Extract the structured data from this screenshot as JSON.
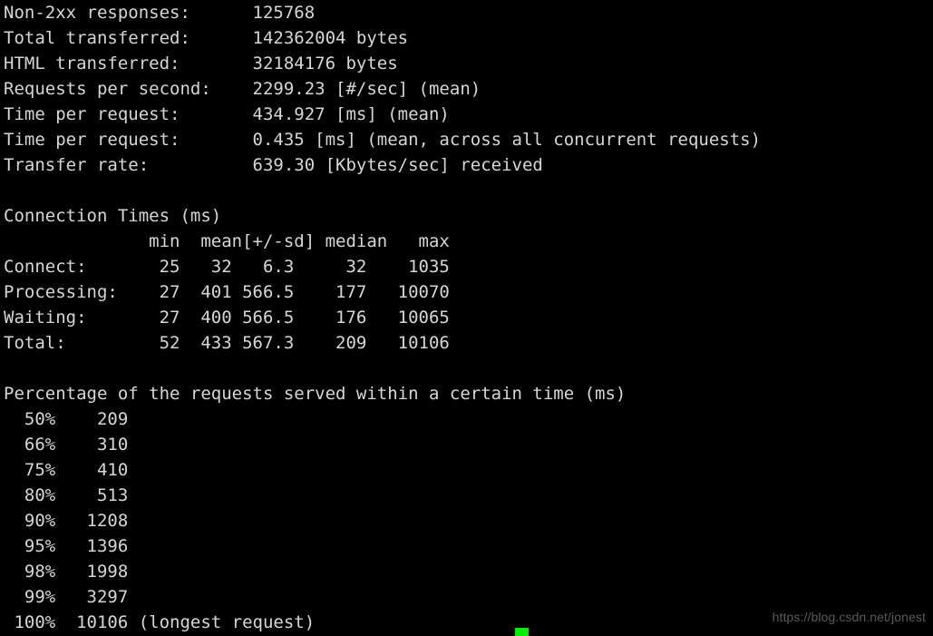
{
  "terminal": {
    "program": "ApacheBench (ab) results output",
    "background_color": "#000000",
    "text_color": "#d6d6d6",
    "summary": {
      "rows": [
        {
          "label": "Non-2xx responses:",
          "value": "125768"
        },
        {
          "label": "Total transferred:",
          "value": "142362004 bytes"
        },
        {
          "label": "HTML transferred:",
          "value": "32184176 bytes"
        },
        {
          "label": "Requests per second:",
          "value": "2299.23 [#/sec] (mean)"
        },
        {
          "label": "Time per request:",
          "value": "434.927 [ms] (mean)"
        },
        {
          "label": "Time per request:",
          "value": "0.435 [ms] (mean, across all concurrent requests)"
        },
        {
          "label": "Transfer rate:",
          "value": "639.30 [Kbytes/sec] received"
        }
      ]
    },
    "connection_times": {
      "title": "Connection Times (ms)",
      "headers": [
        "",
        "min",
        "mean[+/-sd]",
        "median",
        "max"
      ],
      "rows": [
        {
          "name": "Connect:",
          "min": "25",
          "mean": "32",
          "sd": "6.3",
          "median": "32",
          "max": "1035"
        },
        {
          "name": "Processing:",
          "min": "27",
          "mean": "401",
          "sd": "566.5",
          "median": "177",
          "max": "10070"
        },
        {
          "name": "Waiting:",
          "min": "27",
          "mean": "400",
          "sd": "566.5",
          "median": "176",
          "max": "10065"
        },
        {
          "name": "Total:",
          "min": "52",
          "mean": "433",
          "sd": "567.3",
          "median": "209",
          "max": "10106"
        }
      ]
    },
    "percentiles": {
      "title": "Percentage of the requests served within a certain time (ms)",
      "rows": [
        {
          "pct": "50%",
          "value": "209",
          "note": ""
        },
        {
          "pct": "66%",
          "value": "310",
          "note": ""
        },
        {
          "pct": "75%",
          "value": "410",
          "note": ""
        },
        {
          "pct": "80%",
          "value": "513",
          "note": ""
        },
        {
          "pct": "90%",
          "value": "1208",
          "note": ""
        },
        {
          "pct": "95%",
          "value": "1396",
          "note": ""
        },
        {
          "pct": "98%",
          "value": "1998",
          "note": ""
        },
        {
          "pct": "99%",
          "value": "3297",
          "note": ""
        },
        {
          "pct": "100%",
          "value": "10106",
          "note": "(longest request)"
        }
      ]
    },
    "lines": [
      "Non-2xx responses:      125768",
      "Total transferred:      142362004 bytes",
      "HTML transferred:       32184176 bytes",
      "Requests per second:    2299.23 [#/sec] (mean)",
      "Time per request:       434.927 [ms] (mean)",
      "Time per request:       0.435 [ms] (mean, across all concurrent requests)",
      "Transfer rate:          639.30 [Kbytes/sec] received",
      "",
      "Connection Times (ms)",
      "              min  mean[+/-sd] median   max",
      "Connect:       25   32   6.3     32    1035",
      "Processing:    27  401 566.5    177   10070",
      "Waiting:       27  400 566.5    176   10065",
      "Total:         52  433 567.3    209   10106",
      "",
      "Percentage of the requests served within a certain time (ms)",
      "  50%    209",
      "  66%    310",
      "  75%    410",
      "  80%    513",
      "  90%   1208",
      "  95%   1396",
      "  98%   1998",
      "  99%   3297",
      " 100%  10106 (longest request)"
    ],
    "cursor": {
      "color": "#00ee00",
      "shape": "block"
    }
  },
  "watermark": {
    "text": "https://blog.csdn.net/jonest"
  }
}
